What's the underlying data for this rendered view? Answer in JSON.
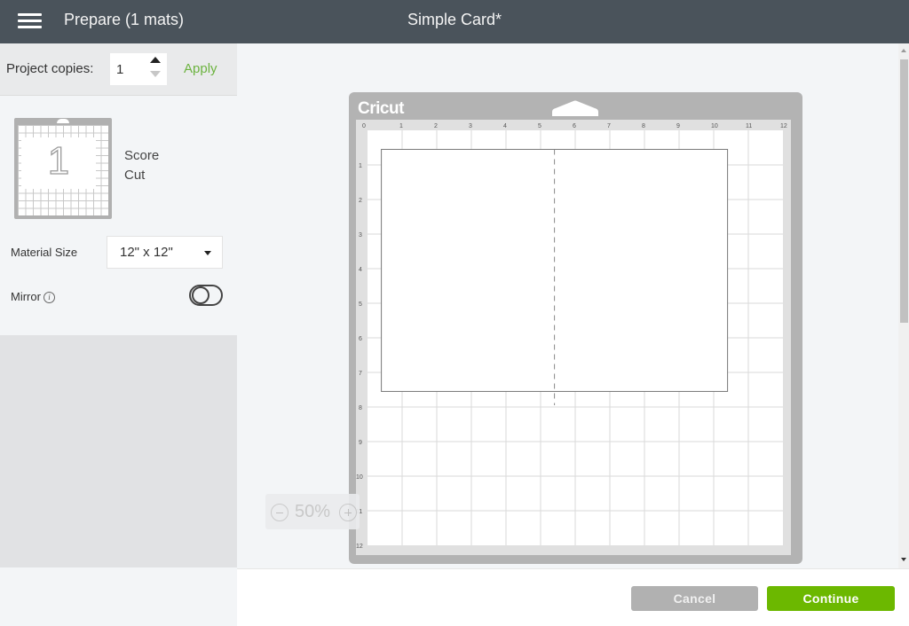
{
  "header": {
    "menu_icon": "hamburger-menu-icon",
    "title": "Prepare (1 mats)",
    "document_title": "Simple Card*"
  },
  "left_panel": {
    "copies_label": "Project copies:",
    "copies_value": "1",
    "apply_label": "Apply",
    "mat_thumbnail": {
      "number": "1",
      "operations": [
        "Score",
        "Cut"
      ]
    },
    "material_size_label": "Material Size",
    "material_size_value": "12\" x 12\"",
    "mirror_label": "Mirror",
    "mirror_info_icon": "i",
    "mirror_enabled": false
  },
  "mat": {
    "brand": "Cricut",
    "ruler_x": [
      "0",
      "1",
      "2",
      "3",
      "4",
      "5",
      "6",
      "7",
      "8",
      "9",
      "10",
      "11",
      "12"
    ],
    "ruler_y": [
      "1",
      "2",
      "3",
      "4",
      "5",
      "6",
      "7",
      "8",
      "9",
      "10",
      "11",
      "12"
    ],
    "size_in": [
      12,
      12
    ],
    "design": {
      "x_in": 0.4,
      "y_in": 0.55,
      "width_in": 10.0,
      "height_in": 7.0,
      "score_line_x_in": 5.4,
      "score_line_y_range_in": [
        0.55,
        7.95
      ]
    }
  },
  "zoom": {
    "value": "50%"
  },
  "footer": {
    "cancel_label": "Cancel",
    "continue_label": "Continue"
  },
  "colors": {
    "header_bg": "#4a535b",
    "accent_green": "#6cb800",
    "apply_green": "#6cb33f",
    "cancel_gray": "#b1b1b1",
    "mat_gray": "#b3b3b3"
  }
}
